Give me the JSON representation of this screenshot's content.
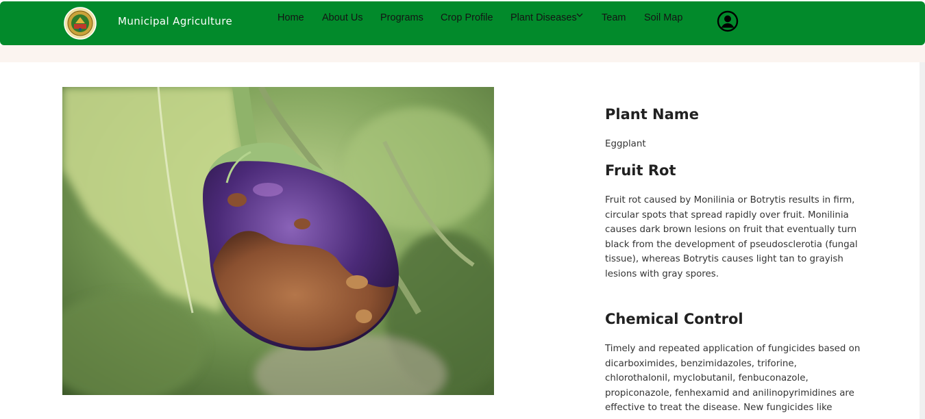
{
  "brand": {
    "name": "Municipal Agriculture"
  },
  "nav": {
    "home": "Home",
    "about": "About Us",
    "programs": "Programs",
    "crop_profile": "Crop Profile",
    "plant_diseases": "Plant Diseases",
    "team": "Team",
    "soil_map": "Soil Map"
  },
  "icons": {
    "logo": "municipal-seal",
    "account": "user-circle-icon",
    "dropdown": "chevron-down-icon"
  },
  "colors": {
    "navbar": "#028a2b",
    "heading": "#212121",
    "body_text": "#333333"
  },
  "disease": {
    "plant_name_heading": "Plant Name",
    "plant_name": "Eggplant",
    "disease_name": "Fruit Rot",
    "description": "Fruit rot caused by Monilinia or Botrytis results in firm, circular spots that spread rapidly over fruit. Monilinia causes dark brown lesions on fruit that eventually turn black from the development of pseudosclerotia (fungal tissue), whereas Botrytis causes light tan to grayish lesions with gray spores.",
    "chemical_control_heading": "Chemical Control",
    "chemical_control": "Timely and repeated application of fungicides based on dicarboximides, benzimidazoles, triforine, chlorothalonil, myclobutanil, fenbuconazole, propiconazole, fenhexamid and anilinopyrimidines are effective to treat the disease. New fungicides like"
  }
}
